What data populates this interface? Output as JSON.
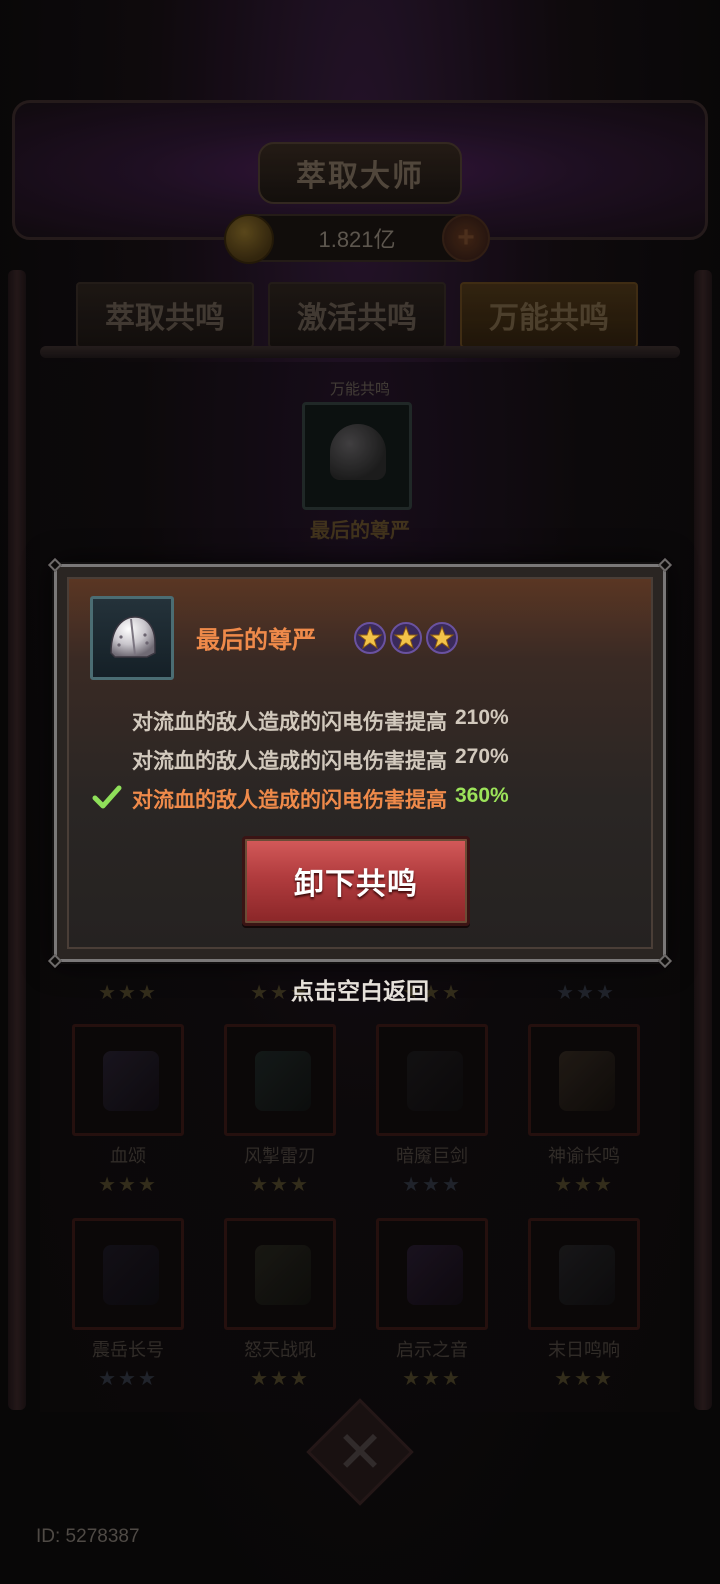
{
  "screen": {
    "title": "萃取大师",
    "currency_amount": "1.821亿",
    "currency_add_label": "+",
    "tabs": [
      {
        "label": "萃取共鸣",
        "active": false
      },
      {
        "label": "激活共鸣",
        "active": false
      },
      {
        "label": "万能共鸣",
        "active": true
      }
    ],
    "slot_label": "万能共鸣",
    "slot_item_name": "最后的尊严",
    "grid_row_partial": [
      {
        "name": "",
        "stars": "★★★",
        "dim": false
      },
      {
        "name": "",
        "stars": "★★★",
        "dim": false
      },
      {
        "name": "",
        "stars": "★★★",
        "dim": false
      },
      {
        "name": "",
        "stars": "★★★",
        "dim": true
      }
    ],
    "grid_row_2": [
      {
        "name": "血颂",
        "stars": "★★★",
        "dim": false
      },
      {
        "name": "风掣雷刃",
        "stars": "★★★",
        "dim": false
      },
      {
        "name": "暗魇巨剑",
        "stars": "★★★",
        "dim": true
      },
      {
        "name": "神谕长鸣",
        "stars": "★★★",
        "dim": false
      }
    ],
    "grid_row_3": [
      {
        "name": "震岳长号",
        "stars": "★★★",
        "dim": true
      },
      {
        "name": "怒天战吼",
        "stars": "★★★",
        "dim": false
      },
      {
        "name": "启示之音",
        "stars": "★★★",
        "dim": false
      },
      {
        "name": "末日鸣响",
        "stars": "★★★",
        "dim": false
      }
    ],
    "close_symbol": "✕",
    "player_id": "ID: 5278387"
  },
  "popup": {
    "item_name": "最后的尊严",
    "star_count": 3,
    "effects": [
      {
        "text": "对流血的敌人造成的闪电伤害提高",
        "value": "210%",
        "active": false
      },
      {
        "text": "对流血的敌人造成的闪电伤害提高",
        "value": "270%",
        "active": false
      },
      {
        "text": "对流血的敌人造成的闪电伤害提高",
        "value": "360%",
        "active": true
      }
    ],
    "unequip_label": "卸下共鸣",
    "tap_hint": "点击空白返回"
  },
  "colors": {
    "title_orange": "#ef8a4a",
    "active_value_green": "#9ce35a",
    "button_red": "#b13c3e"
  }
}
